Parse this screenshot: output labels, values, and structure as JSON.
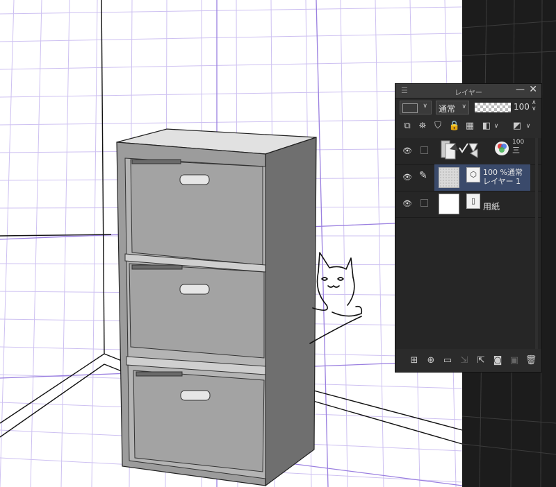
{
  "panel": {
    "title": "レイヤー",
    "blend_mode": "通常",
    "opacity_value": "100",
    "window_min": "—",
    "window_close": "✕"
  },
  "layers": [
    {
      "type": "folder",
      "opacity_fragment": "100",
      "mode_fragment": "三"
    },
    {
      "type": "raster",
      "opacity": "100 %",
      "mode": "通常",
      "name": "レイヤー 1",
      "selected": true
    },
    {
      "type": "paper",
      "name": "用紙"
    }
  ],
  "icons": {
    "panel_menu": "hamburger-icon",
    "eye": "eye-icon",
    "pen": "pen-icon",
    "lock": "lock-icon",
    "trash": "trash-icon"
  },
  "colors": {
    "panel_bg": "#2b2b2b",
    "selected_row": "#3a4a6b",
    "perspective_grid": "#b6a4e8",
    "dark_bg": "#1c1c1c"
  }
}
